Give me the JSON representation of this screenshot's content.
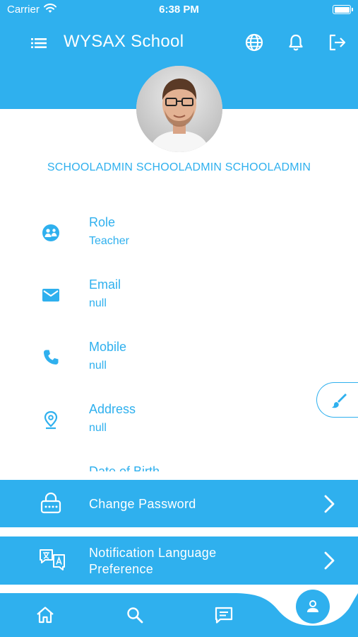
{
  "status_bar": {
    "carrier": "Carrier",
    "time": "6:38 PM"
  },
  "app_bar": {
    "title": "WYSAX School"
  },
  "profile": {
    "name": "SCHOOLADMIN SCHOOLADMIN SCHOOLADMIN"
  },
  "info_items": [
    {
      "label": "Role",
      "value": "Teacher",
      "icon": "role-icon"
    },
    {
      "label": "Email",
      "value": "null",
      "icon": "email-icon"
    },
    {
      "label": "Mobile",
      "value": "null",
      "icon": "phone-icon"
    },
    {
      "label": "Address",
      "value": "null",
      "icon": "location-pin-icon"
    },
    {
      "label": "Date of Birth",
      "value": "",
      "icon": "calendar-icon"
    }
  ],
  "actions": {
    "change_password": "Change Password",
    "notification_language_line1": "Notification Language",
    "notification_language_line2": "Preference"
  },
  "colors": {
    "primary": "#2fb0ee",
    "background": "#ffffff"
  }
}
